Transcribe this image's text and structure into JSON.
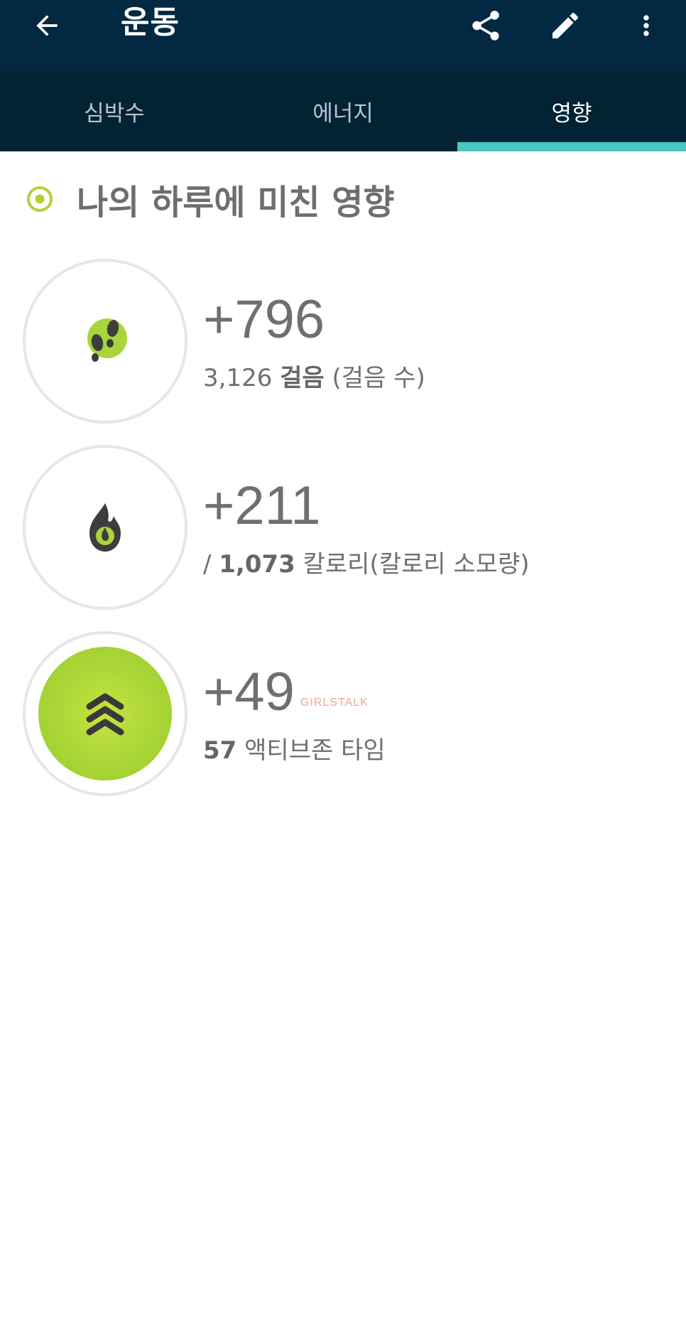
{
  "header": {
    "title": "운동",
    "icons": {
      "back": "arrow-left-icon",
      "share": "share-icon",
      "edit": "pencil-icon",
      "more": "more-vertical-icon"
    }
  },
  "tabs": [
    {
      "label": "심박수",
      "active": false
    },
    {
      "label": "에너지",
      "active": false
    },
    {
      "label": "영향",
      "active": true
    }
  ],
  "section": {
    "title": "나의 하루에 미친 영향",
    "icon": "target-icon"
  },
  "metrics": [
    {
      "delta": "+796",
      "prefix": "",
      "value": "3,126",
      "unit": "걸음",
      "note": "(걸음 수)",
      "icon": "footprints-icon"
    },
    {
      "delta": "+211",
      "prefix": "/ ",
      "value": "1,073",
      "unit": "칼로리",
      "note": "(칼로리 소모량)",
      "icon": "flame-icon"
    },
    {
      "delta": "+49",
      "prefix": "",
      "value": "57",
      "unit": "액티브존 타임",
      "note": "",
      "icon": "chevrons-up-icon",
      "watermark": "GIRLSTALK"
    }
  ],
  "colors": {
    "appbar": "#032841",
    "tabbar": "#012333",
    "tab_indicator": "#4cc6c2",
    "accent_green": "#a4d233",
    "text_gray": "#6f6f6f"
  }
}
